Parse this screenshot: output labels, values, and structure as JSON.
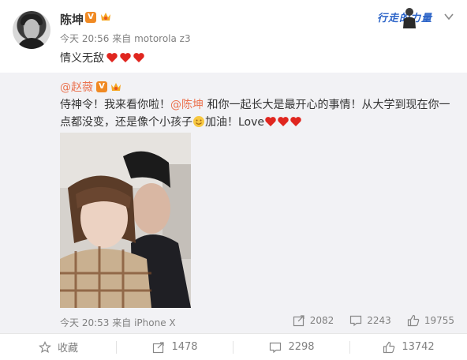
{
  "post": {
    "username": "陈坤",
    "time": "今天 20:56",
    "source_prefix": "来自",
    "source": "motorola z3",
    "text": "情义无敌",
    "verified_label": "V"
  },
  "promo": {
    "text": "行走的力量"
  },
  "repost": {
    "username": "@赵薇",
    "verified_label": "V",
    "text_part1": "侍神令！我来看你啦！",
    "mention": "@陈坤",
    "text_part2": " 和你一起长大是最开心的事情！从大学到现在你一点都没变，还是像个小孩子",
    "text_part3": "加油！Love",
    "time": "今天 20:53",
    "source_prefix": "来自",
    "source": "iPhone X",
    "reposts": "2082",
    "comments": "2243",
    "likes": "19755"
  },
  "footer": {
    "favorite_label": "收藏",
    "reposts": "1478",
    "comments": "2298",
    "likes": "13742"
  },
  "colors": {
    "accent_orange": "#eb7350",
    "heart_red": "#e0261f",
    "verified_orange": "#f08a24",
    "repost_bg": "#f2f2f5"
  }
}
